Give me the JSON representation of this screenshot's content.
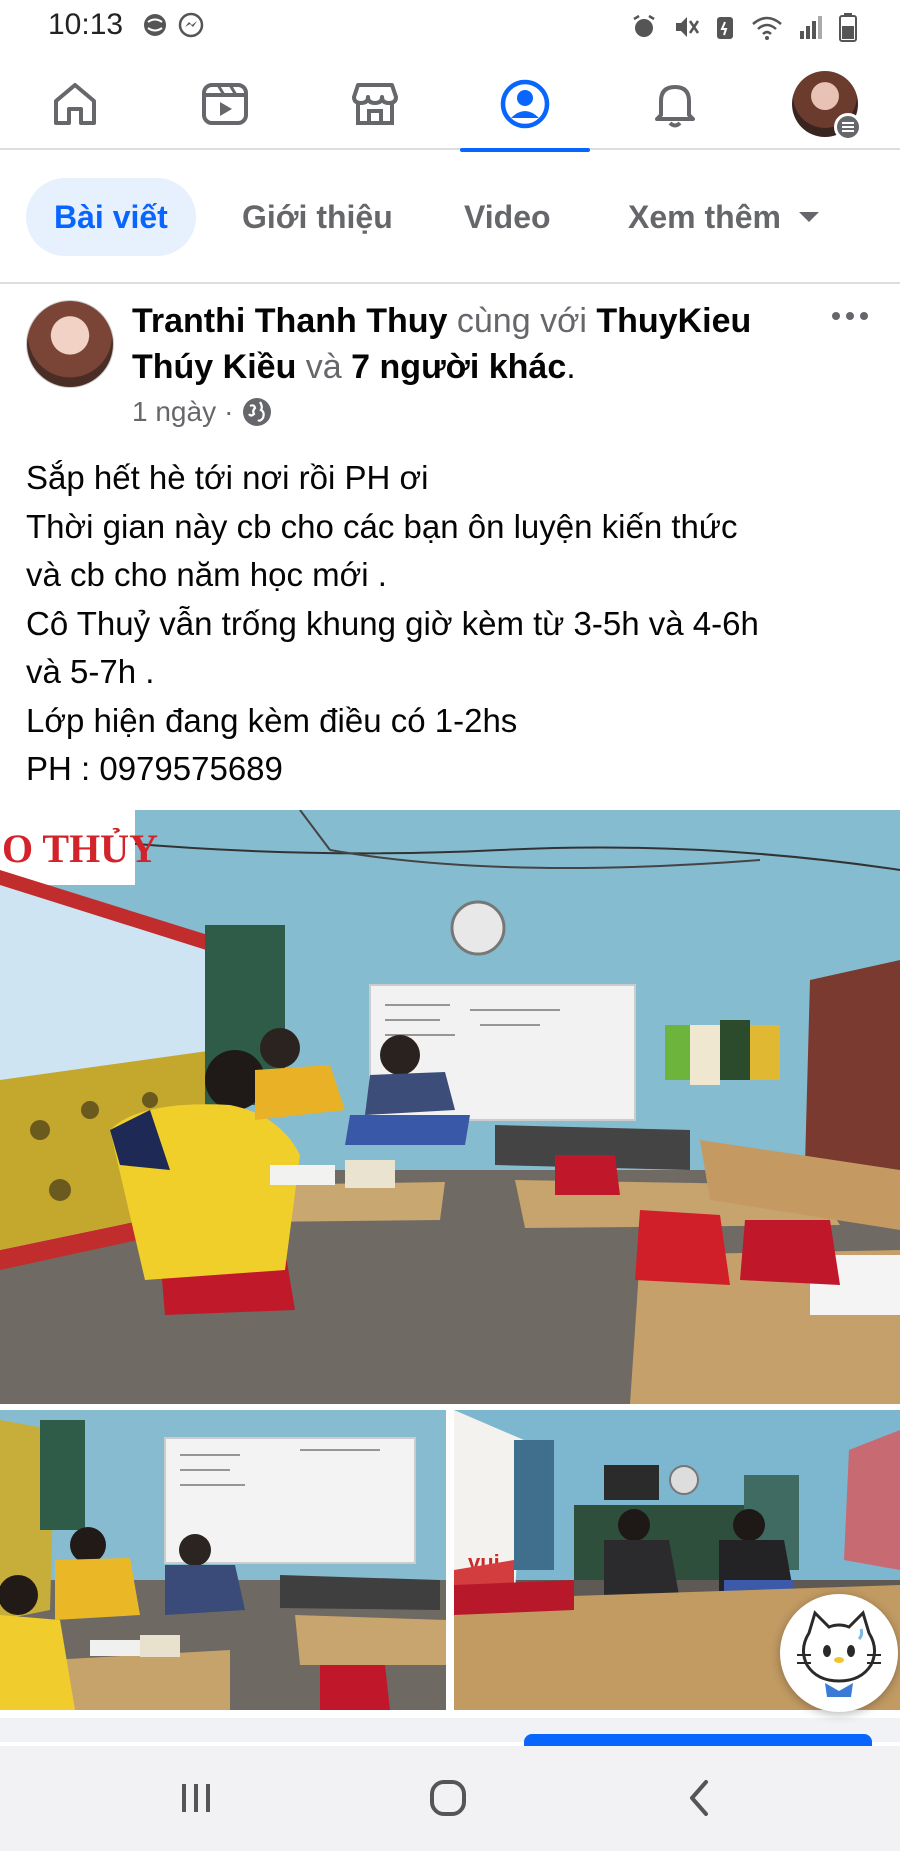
{
  "status_bar": {
    "time": "10:13",
    "left_icons": [
      "browser-icon",
      "messenger-icon"
    ],
    "right_icons": [
      "alarm-icon",
      "mute-icon",
      "battery-saver-icon",
      "wifi-icon",
      "signal-icon",
      "battery-icon"
    ]
  },
  "top_nav": {
    "items": [
      {
        "icon": "home-icon",
        "active": false
      },
      {
        "icon": "video-icon",
        "active": false
      },
      {
        "icon": "marketplace-icon",
        "active": false
      },
      {
        "icon": "profile-icon",
        "active": true
      },
      {
        "icon": "bell-icon",
        "active": false
      },
      {
        "icon": "menu-avatar",
        "active": false
      }
    ]
  },
  "profile_tabs": {
    "items": [
      {
        "label": "Bài viết",
        "active": true
      },
      {
        "label": "Giới thiệu",
        "active": false
      },
      {
        "label": "Video",
        "active": false
      },
      {
        "label": "Xem thêm",
        "active": false
      }
    ]
  },
  "post": {
    "author": "Tranthi Thanh Thuy",
    "with_text": "cùng với",
    "tagged_name_1": "ThuyKieu",
    "tagged_name_2": "Thúy Kiều",
    "and_text": "và",
    "others_text": "7 người khác",
    "period": ".",
    "time": "1 ngày",
    "separator": "·",
    "privacy_icon": "globe-icon",
    "text_lines": [
      "Sắp hết hè tới nơi rồi PH ơi",
      "Thời gian này cb cho các bạn ôn luyện kiến thức",
      "và cb cho năm học mới .",
      "Cô Thuỷ vẫn trống khung giờ kèm từ 3-5h và 4-6h",
      "và 5-7h .",
      "Lớp hiện đang kèm điều có 1-2hs",
      "PH : 0979575689"
    ],
    "photo_sign_text": "O THỦY",
    "photo_b2_sign_text": "vui"
  },
  "colors": {
    "accent": "#0866ff",
    "muted": "#65676b",
    "text": "#050505",
    "divider": "#dadde1"
  }
}
